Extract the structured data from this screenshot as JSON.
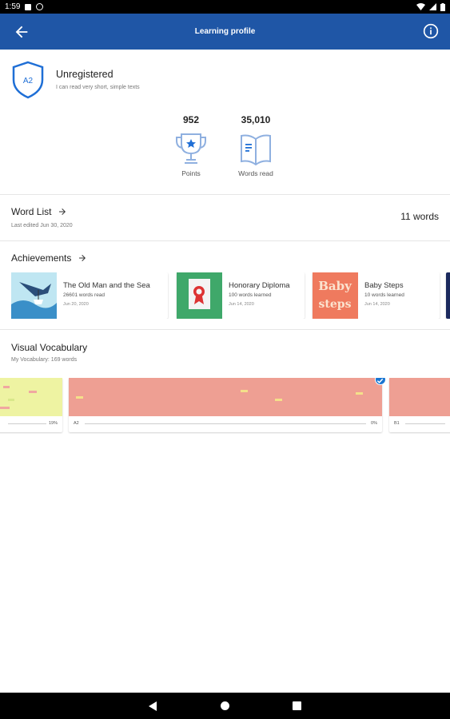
{
  "status_bar": {
    "time": "1:59"
  },
  "app_bar": {
    "title": "Learning profile",
    "color": "#1f56a6"
  },
  "profile": {
    "level_badge": "A2",
    "status": "Unregistered",
    "description": "I can read very short, simple texts"
  },
  "stats": {
    "points_value": "952",
    "points_label": "Points",
    "words_value": "35,010",
    "words_label": "Words read"
  },
  "word_list": {
    "title": "Word List",
    "subtitle": "Last edited Jun 30, 2020",
    "count": "11 words"
  },
  "achievements": {
    "title": "Achievements",
    "items": [
      {
        "title": "The Old Man and the Sea",
        "detail": "26601 words read",
        "date": "Jun 20, 2020"
      },
      {
        "title": "Honorary Diploma",
        "detail": "100 words learned",
        "date": "Jun 14, 2020"
      },
      {
        "title": "Baby Steps",
        "detail": "10 words learned",
        "date": "Jun 14, 2020",
        "thumb_text_1": "Baby",
        "thumb_text_2": "steps"
      }
    ]
  },
  "visual_vocabulary": {
    "title": "Visual Vocabulary",
    "subtitle": "My Vocabulary: 169 words",
    "cards": [
      {
        "level": "",
        "percent": "19%",
        "color": "#eef3a2"
      },
      {
        "level": "A2",
        "percent": "0%",
        "color": "#ee9f93"
      },
      {
        "level": "B1",
        "percent": "",
        "color": "#ee9f93"
      }
    ]
  }
}
